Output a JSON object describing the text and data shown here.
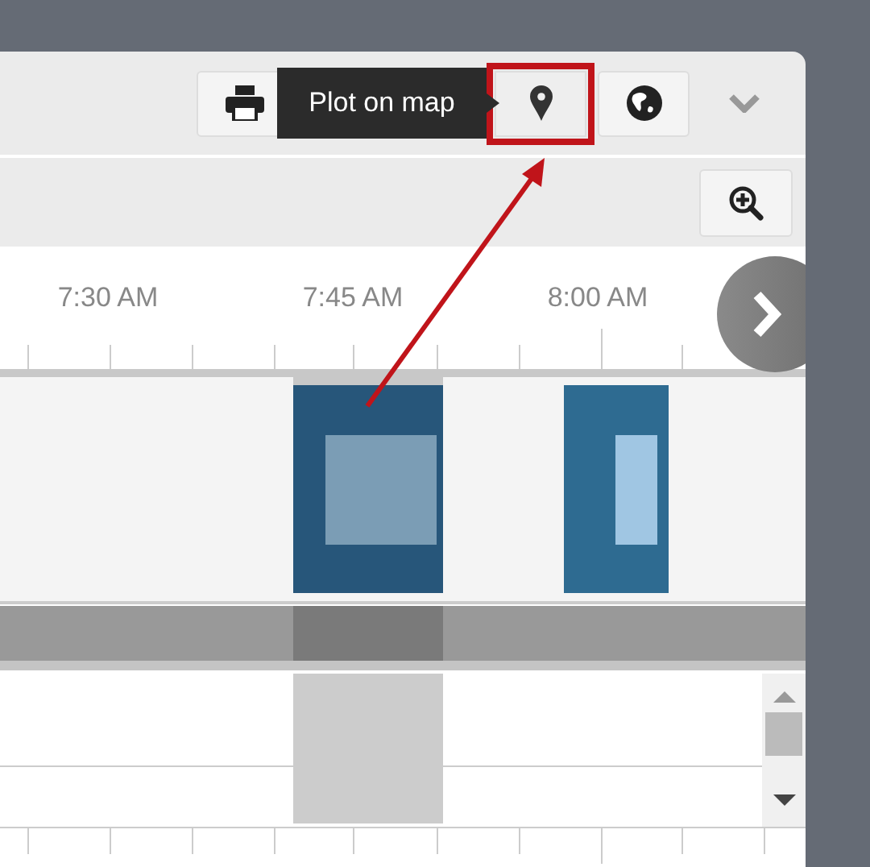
{
  "toolbar": {
    "tooltip": "Plot on map",
    "buttons": [
      {
        "kind": "print",
        "highlighted": false
      },
      {
        "kind": "pin",
        "highlighted": true
      },
      {
        "kind": "globe",
        "highlighted": false
      }
    ]
  },
  "timeline": {
    "time_labels": [
      "7:30 AM",
      "7:45 AM",
      "8:00 AM"
    ],
    "events": [
      {
        "selected": true
      },
      {
        "selected": false
      }
    ]
  }
}
